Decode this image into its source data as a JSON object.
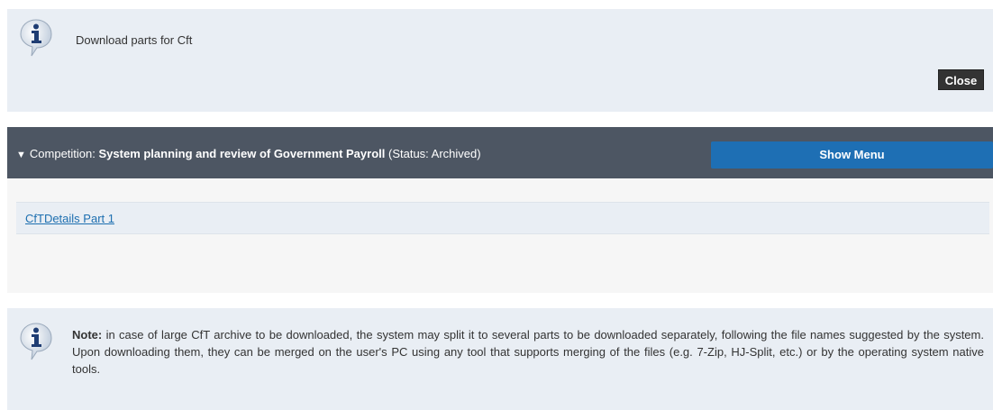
{
  "top_info": {
    "title": "Download parts for Cft",
    "close_label": "Close"
  },
  "competition": {
    "prefix": "Competition:",
    "name": "System planning and review of Government Payroll",
    "status": "(Status: Archived)",
    "show_menu_label": "Show Menu"
  },
  "parts": [
    {
      "label": "CfTDetails Part 1"
    }
  ],
  "note": {
    "label": "Note:",
    "text": "in case of large CfT archive to be downloaded, the system may split it to several parts to be downloaded separately, following the file names suggested by the system. Upon downloading them, they can be merged on the user's PC using any tool that supports merging of the files (e.g. 7-Zip, HJ-Split, etc.) or by the operating system native tools."
  },
  "icons": {
    "info": "info-icon",
    "chevron": "chevron-down-icon"
  },
  "colors": {
    "info_bg": "#e9eef4",
    "bar_bg": "#4d5663",
    "accent": "#1e6fb4",
    "link": "#1d6fb0"
  }
}
